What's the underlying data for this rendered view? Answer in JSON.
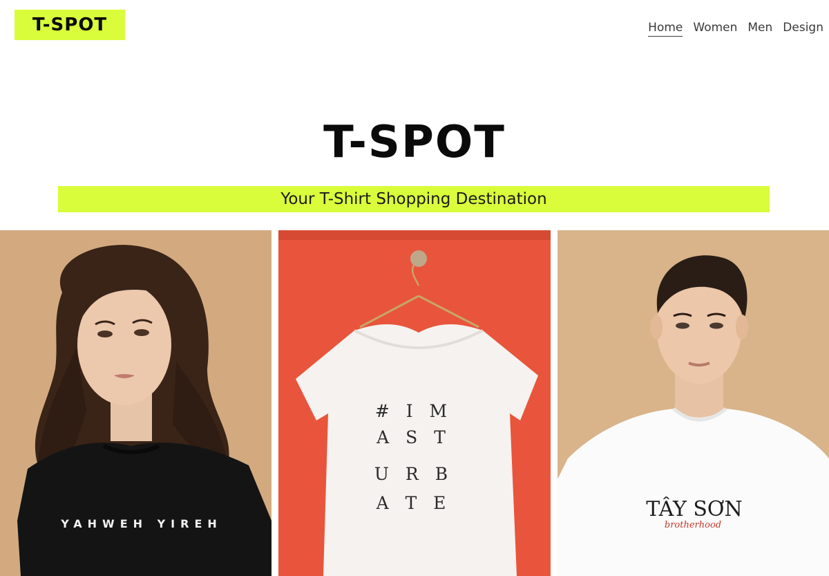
{
  "header": {
    "logo_text": "T-SPOT",
    "nav": [
      {
        "label": "Home",
        "active": true
      },
      {
        "label": "Women",
        "active": false
      },
      {
        "label": "Men",
        "active": false
      },
      {
        "label": "Design",
        "active": false
      }
    ]
  },
  "hero": {
    "title": "T-SPOT",
    "tagline": "Your T-Shirt Shopping Destination"
  },
  "gallery": {
    "items": [
      {
        "shirt_color": "black",
        "print_text": "YAHWEH YIREH"
      },
      {
        "shirt_color": "white",
        "print_lines": [
          "# I M",
          "A S T",
          "U R B",
          "A T E"
        ]
      },
      {
        "shirt_color": "white",
        "print_title": "TÂY SƠN",
        "print_sub": "brotherhood"
      }
    ]
  },
  "colors": {
    "accent": "#d9fd3a",
    "beige_bg": "#d3aa7f",
    "red_bg": "#e8553c"
  }
}
